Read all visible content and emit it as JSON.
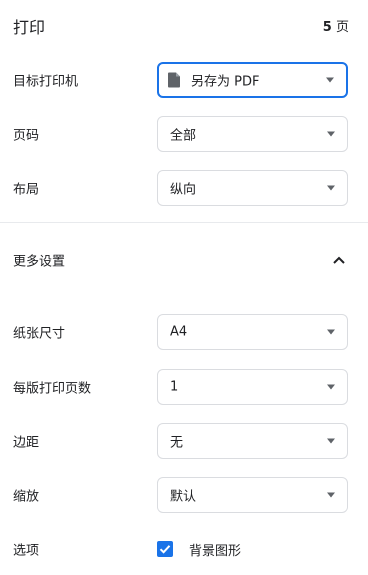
{
  "header": {
    "title": "打印",
    "page_count_number": "5",
    "page_count_unit": "页"
  },
  "destination": {
    "label": "目标打印机",
    "value": "另存为 PDF",
    "icon": "file-icon"
  },
  "pages": {
    "label": "页码",
    "value": "全部"
  },
  "layout": {
    "label": "布局",
    "value": "纵向"
  },
  "more_settings": {
    "label": "更多设置",
    "icon": "chevron-up-icon"
  },
  "paper_size": {
    "label": "纸张尺寸",
    "value": "A4"
  },
  "pages_per_sheet": {
    "label": "每版打印页数",
    "value": "1"
  },
  "margins": {
    "label": "边距",
    "value": "无"
  },
  "scale": {
    "label": "缩放",
    "value": "默认"
  },
  "options": {
    "label": "选项",
    "background_graphics": {
      "label": "背景图形",
      "checked": true
    }
  },
  "colors": {
    "accent": "#1a73e8",
    "border": "#dadce0",
    "text": "#202124"
  }
}
